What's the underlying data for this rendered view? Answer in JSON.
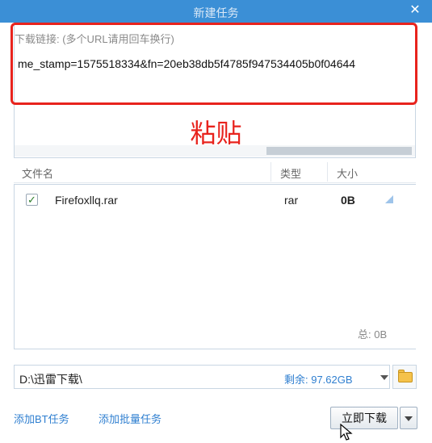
{
  "window": {
    "title": "新建任务"
  },
  "url_input": {
    "label": "下载链接: (多个URL请用回车换行)",
    "value": "me_stamp=1575518334&fn=20eb38db5f4785f947534405b0f04644"
  },
  "annotation": {
    "text": "粘贴",
    "color": "#e8231d"
  },
  "file_list": {
    "columns": [
      "文件名",
      "类型",
      "大小"
    ],
    "rows": [
      {
        "checked": true,
        "name": "Firefoxllq.rar",
        "type": "rar",
        "size": "0B"
      }
    ],
    "total": "总: 0B"
  },
  "save_path": {
    "value": "D:\\迅雷下载\\",
    "free_space": "剩余: 97.62GB"
  },
  "footer": {
    "add_bt_task": "添加BT任务",
    "add_batch_task": "添加批量任务",
    "download_now": "立即下载"
  },
  "colors": {
    "accent": "#2f7fd0",
    "titlebar": "#3b8fd6"
  }
}
